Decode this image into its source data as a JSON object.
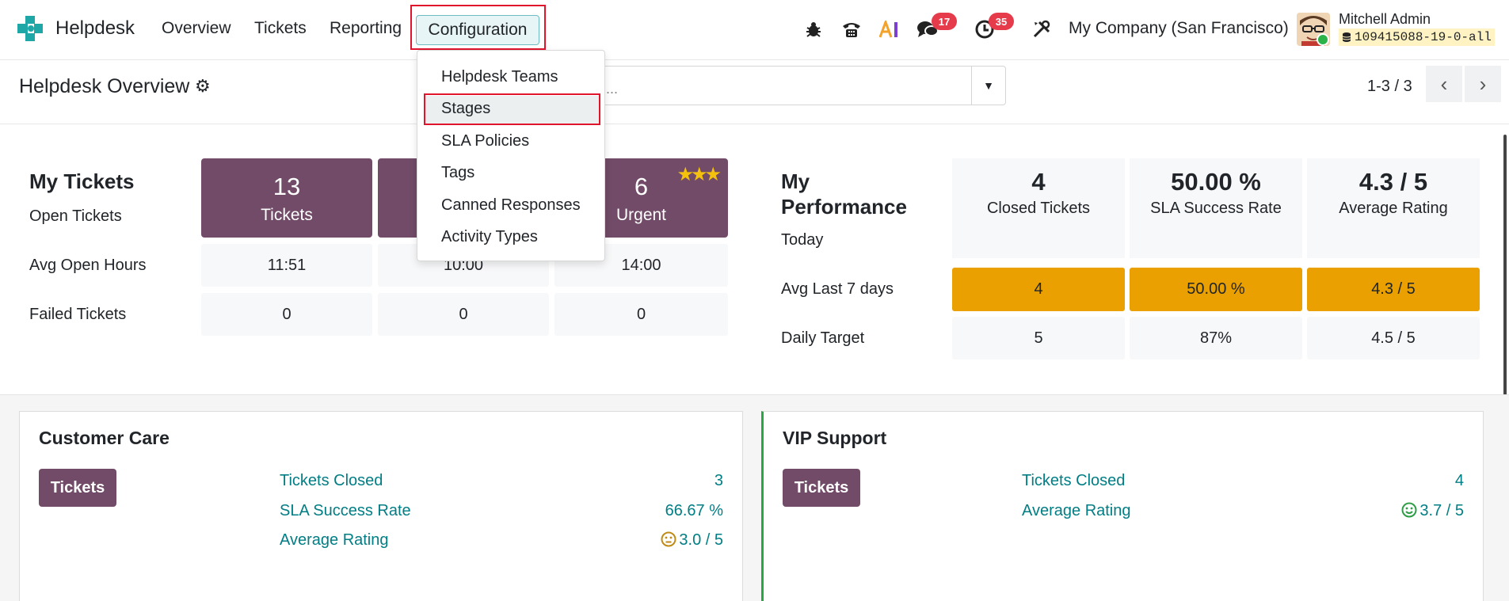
{
  "app": {
    "brand": "Helpdesk",
    "nav": [
      "Overview",
      "Tickets",
      "Reporting"
    ],
    "active_nav": "Configuration",
    "company": "My Company (San Francisco)",
    "user": "Mitchell Admin",
    "database": "109415088-19-0-all",
    "badges": {
      "messages": "17",
      "activities": "35"
    }
  },
  "control": {
    "title": "Helpdesk Overview",
    "search_placeholder": "...",
    "pager": "1-3 / 3"
  },
  "dropdown": {
    "items": [
      "Helpdesk Teams",
      "Stages",
      "SLA Policies",
      "Tags",
      "Canned Responses",
      "Activity Types"
    ],
    "highlighted": "Stages"
  },
  "my_tickets": {
    "title": "My Tickets",
    "row_labels": [
      "Open Tickets",
      "Avg Open Hours",
      "Failed Tickets"
    ],
    "tiles": [
      {
        "number": "13",
        "label": "Tickets"
      },
      {
        "number": "6",
        "label": "Urgent"
      }
    ],
    "avg_open_hours": [
      "11:51",
      "10:00",
      "14:00"
    ],
    "failed_tickets": [
      "0",
      "0",
      "0"
    ]
  },
  "my_performance": {
    "title_line1": "My",
    "title_line2": "Performance",
    "row_labels": [
      "Today",
      "Avg Last 7 days",
      "Daily Target"
    ],
    "tiles": [
      {
        "number": "4",
        "label": "Closed Tickets"
      },
      {
        "number": "50.00 %",
        "label": "SLA Success Rate"
      },
      {
        "number": "4.3 / 5",
        "label": "Average Rating"
      }
    ],
    "avg_last_7_days": [
      "4",
      "50.00 %",
      "4.3 / 5"
    ],
    "daily_target": [
      "5",
      "87%",
      "4.5 / 5"
    ]
  },
  "teams": [
    {
      "name": "Customer Care",
      "button": "Tickets",
      "stats": [
        {
          "label": "Tickets Closed",
          "value": "3"
        },
        {
          "label": "SLA Success Rate",
          "value": "66.67 %"
        },
        {
          "label": "Average Rating",
          "value": "3.0 / 5"
        }
      ]
    },
    {
      "name": "VIP Support",
      "button": "Tickets",
      "stats": [
        {
          "label": "Tickets Closed",
          "value": "4"
        },
        {
          "label": "Average Rating",
          "value": "3.7 / 5"
        }
      ]
    }
  ],
  "colors": {
    "primary": "#714b67",
    "orange": "#e9a000",
    "teal": "#017e84",
    "highlight": "#e0142b",
    "rating_neutral": "#c08a17",
    "rating_good": "#2e9e46"
  }
}
